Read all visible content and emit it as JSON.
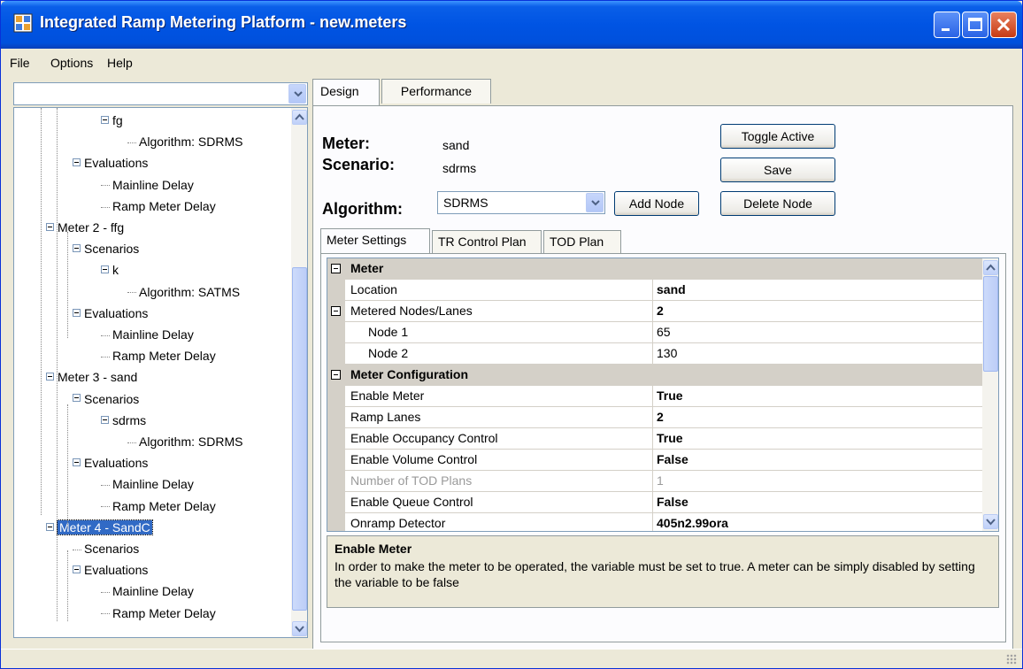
{
  "window": {
    "title": "Integrated Ramp Metering Platform - new.meters",
    "icon": "app-window-icon"
  },
  "menu": [
    "File",
    "Options",
    "Help"
  ],
  "tree": {
    "dropdown_value": "",
    "nodes": [
      {
        "label": "fg",
        "level": 3,
        "type": "expanded"
      },
      {
        "label": "Algorithm: SDRMS",
        "level": 4,
        "type": "leaf"
      },
      {
        "label": "Evaluations",
        "level": 2,
        "type": "expanded"
      },
      {
        "label": "Mainline Delay",
        "level": 3,
        "type": "leaf"
      },
      {
        "label": "Ramp Meter Delay",
        "level": 3,
        "type": "leaf"
      },
      {
        "label": "Meter 2 - ffg",
        "level": 1,
        "type": "expanded"
      },
      {
        "label": "Scenarios",
        "level": 2,
        "type": "expanded"
      },
      {
        "label": "k",
        "level": 3,
        "type": "expanded"
      },
      {
        "label": "Algorithm: SATMS",
        "level": 4,
        "type": "leaf"
      },
      {
        "label": "Evaluations",
        "level": 2,
        "type": "expanded"
      },
      {
        "label": "Mainline Delay",
        "level": 3,
        "type": "leaf"
      },
      {
        "label": "Ramp Meter Delay",
        "level": 3,
        "type": "leaf"
      },
      {
        "label": "Meter 3 - sand",
        "level": 1,
        "type": "expanded"
      },
      {
        "label": "Scenarios",
        "level": 2,
        "type": "expanded"
      },
      {
        "label": "sdrms",
        "level": 3,
        "type": "expanded"
      },
      {
        "label": "Algorithm: SDRMS",
        "level": 4,
        "type": "leaf"
      },
      {
        "label": "Evaluations",
        "level": 2,
        "type": "expanded"
      },
      {
        "label": "Mainline Delay",
        "level": 3,
        "type": "leaf"
      },
      {
        "label": "Ramp Meter Delay",
        "level": 3,
        "type": "leaf"
      },
      {
        "label": "Meter 4 - SandC",
        "level": 1,
        "type": "expanded",
        "selected": true
      },
      {
        "label": "Scenarios",
        "level": 2,
        "type": "leaf"
      },
      {
        "label": "Evaluations",
        "level": 2,
        "type": "expanded"
      },
      {
        "label": "Mainline Delay",
        "level": 3,
        "type": "leaf"
      },
      {
        "label": "Ramp Meter Delay",
        "level": 3,
        "type": "leaf"
      }
    ]
  },
  "tabs": [
    "Design",
    "Performance"
  ],
  "design": {
    "meter_label": "Meter:",
    "meter_value": "sand",
    "scenario_label": "Scenario:",
    "scenario_value": "sdrms",
    "algorithm_label": "Algorithm:",
    "algorithm_value": "SDRMS",
    "buttons": {
      "toggle_active": "Toggle Active",
      "save": "Save",
      "add_node": "Add Node",
      "delete_node": "Delete Node"
    }
  },
  "subtabs": [
    "Meter Settings",
    "TR Control Plan",
    "TOD Plan"
  ],
  "grid_rows": [
    {
      "kind": "category",
      "name": "Meter"
    },
    {
      "kind": "prop",
      "name": "Location",
      "value": "sand",
      "bold": true
    },
    {
      "kind": "group",
      "name": "Metered Nodes/Lanes",
      "value": "2",
      "bold": true
    },
    {
      "kind": "nested",
      "name": "Node 1",
      "value": "65"
    },
    {
      "kind": "nested",
      "name": "Node 2",
      "value": "130"
    },
    {
      "kind": "category",
      "name": "Meter Configuration"
    },
    {
      "kind": "prop",
      "name": "Enable Meter",
      "value": "True",
      "bold": true
    },
    {
      "kind": "prop",
      "name": "Ramp Lanes",
      "value": "2",
      "bold": true
    },
    {
      "kind": "prop",
      "name": "Enable Occupancy Control",
      "value": "True",
      "bold": true
    },
    {
      "kind": "prop",
      "name": "Enable Volume Control",
      "value": "False",
      "bold": true
    },
    {
      "kind": "disabled",
      "name": "Number of TOD Plans",
      "value": "1"
    },
    {
      "kind": "prop",
      "name": "Enable Queue Control",
      "value": "False",
      "bold": true
    },
    {
      "kind": "prop",
      "name": "Onramp Detector",
      "value": "405n2.99ora",
      "bold": true
    }
  ],
  "help": {
    "title": "Enable Meter",
    "description": "In order to make the meter to be operated, the variable must be set to true. A meter can be simply disabled by setting the variable to be false"
  },
  "colors": {
    "titlebar": "#0054e3",
    "selection": "#316ac5",
    "category_bg": "#d4d0c8"
  }
}
